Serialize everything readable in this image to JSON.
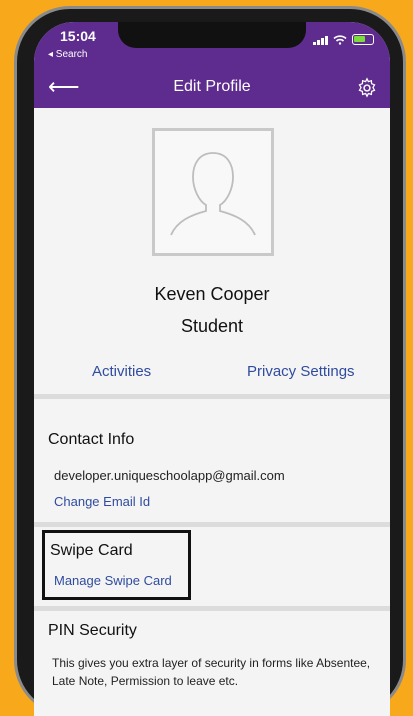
{
  "status_bar": {
    "time": "15:04",
    "back_label": "◂ Search"
  },
  "navbar": {
    "title": "Edit Profile",
    "back_icon": "back-arrow-icon",
    "settings_icon": "gear-icon",
    "color": "#5e2b8e"
  },
  "profile": {
    "name": "Keven Cooper",
    "role": "Student"
  },
  "links": {
    "activities": "Activities",
    "privacy": "Privacy Settings"
  },
  "contact": {
    "title": "Contact Info",
    "email": "developer.uniqueschoolapp@gmail.com",
    "change_email": "Change Email Id"
  },
  "swipe": {
    "title": "Swipe Card",
    "manage": "Manage Swipe Card"
  },
  "pin": {
    "title": "PIN Security",
    "description": "This gives you extra layer of security in forms like Absentee, Late Note, Permission to leave etc."
  }
}
